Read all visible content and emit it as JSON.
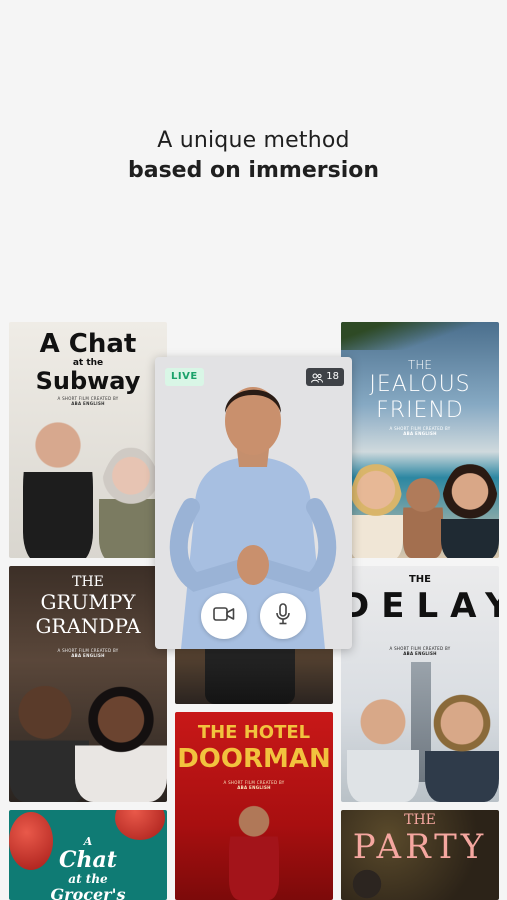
{
  "headline": {
    "line1": "A unique method",
    "line2": "based on immersion"
  },
  "live": {
    "badge": "LIVE",
    "viewers": "18"
  },
  "posters": {
    "chat_subway": {
      "title_1": "A Chat",
      "title_2": "at the",
      "title_3": "Subway",
      "credit_1": "A SHORT FILM CREATED BY",
      "credit_2": "ABA ENGLISH"
    },
    "jealous": {
      "title_1": "THE",
      "title_2": "JEALOUS",
      "title_3": "FRIEND",
      "credit_1": "A SHORT FILM CREATED BY",
      "credit_2": "ABA ENGLISH"
    },
    "grumpy": {
      "title_1": "THE",
      "title_2": "GRUMPY",
      "title_3": "GRANDPA",
      "credit_1": "A SHORT FILM CREATED BY",
      "credit_2": "ABA ENGLISH"
    },
    "delay": {
      "title_1": "THE",
      "title_2": "DELAY",
      "credit_1": "A SHORT FILM CREATED BY",
      "credit_2": "ABA ENGLISH"
    },
    "doorman": {
      "title_1": "THE HOTEL",
      "title_2": "DOORMAN",
      "credit_1": "A SHORT FILM CREATED BY",
      "credit_2": "ABA ENGLISH"
    },
    "grocer": {
      "title_1": "A",
      "title_2": "Chat",
      "title_3": "at the",
      "title_4": "Grocer's"
    },
    "party": {
      "title_1": "THE",
      "title_2": "PARTY"
    }
  },
  "icons": {
    "video": "video-camera-icon",
    "mic": "microphone-icon",
    "viewers": "people-icon"
  }
}
